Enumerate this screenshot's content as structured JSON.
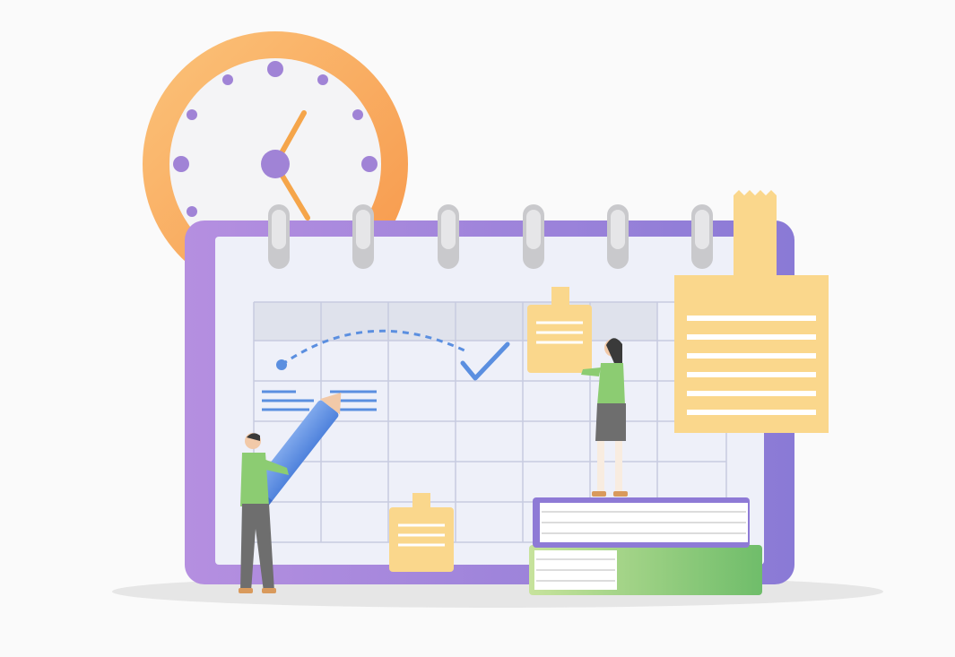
{
  "scene": {
    "subject": "schedule-planning",
    "elements": [
      "wall-clock",
      "spiral-calendar",
      "sticky-notes",
      "book-stack",
      "person-with-pencil",
      "person-pinning-note"
    ]
  },
  "colors": {
    "background": "#fafafa",
    "shadow": "#e6e6e6",
    "calendar_frame": "#a083d6",
    "calendar_paper": "#eef0f9",
    "grid_lines": "#c7cbe0",
    "grid_header": "#dfe2ec",
    "clock_ring": "#f7a24c",
    "clock_face": "#f4f4f6",
    "clock_dots": "#a083d6",
    "clock_hands": "#f5a54a",
    "spiral_ring": "#c9c9cc",
    "sticky_note": "#fad78c",
    "note_lines": "#ffffff",
    "dashed_arc": "#5b8fe0",
    "check_mark": "#5b8fe0",
    "pencil": "#5b8fe0",
    "book_cover_purple": "#8e7ad6",
    "book_cover_green": "#82c46e",
    "person_shirt": "#8ccc72",
    "person_pants": "#6e6e6e",
    "person_hair": "#3a3a3a",
    "person_skin": "#f2c9a8"
  }
}
